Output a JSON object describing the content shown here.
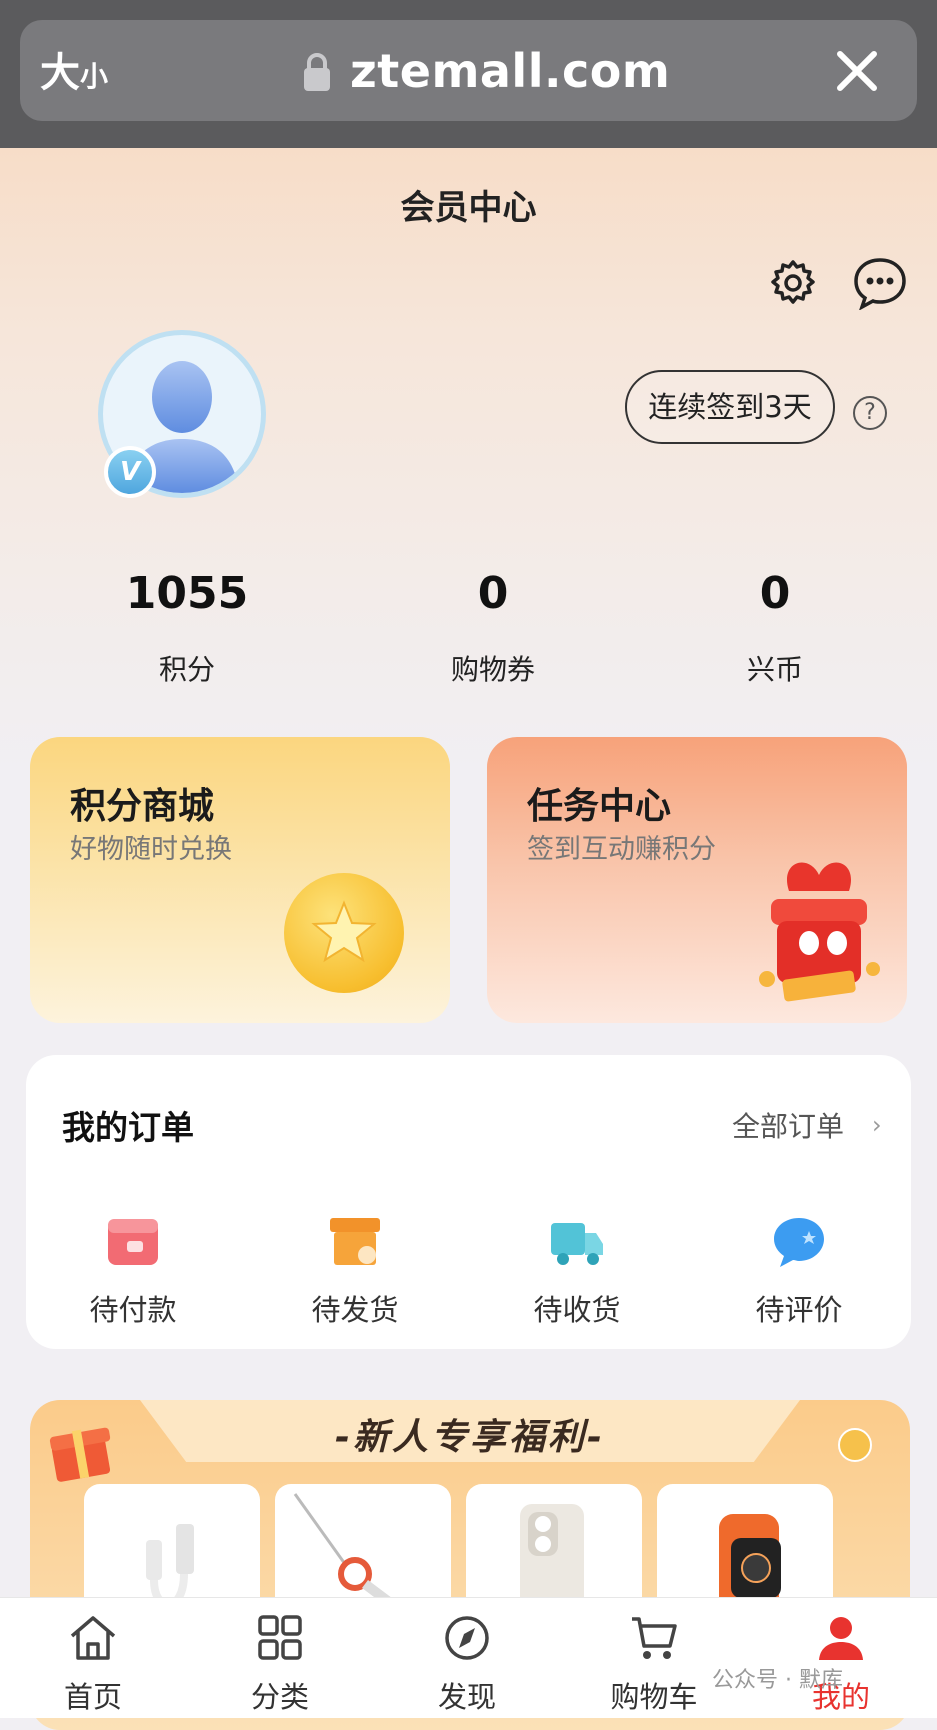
{
  "browser": {
    "size_label_big": "大",
    "size_label_small": "小",
    "url": "ztemall.com"
  },
  "page": {
    "title": "会员中心"
  },
  "user": {
    "badge": "V",
    "checkin_label": "连续签到3天",
    "help_label": "?"
  },
  "stats": [
    {
      "value": "1055",
      "label": "积分"
    },
    {
      "value": "0",
      "label": "购物券"
    },
    {
      "value": "0",
      "label": "兴币"
    }
  ],
  "cards": [
    {
      "title": "积分商城",
      "subtitle": "好物随时兑换"
    },
    {
      "title": "任务中心",
      "subtitle": "签到互动赚积分"
    }
  ],
  "orders": {
    "title": "我的订单",
    "all_label": "全部订单",
    "chevron": "›",
    "items": [
      {
        "label": "待付款",
        "icon": "wallet-icon",
        "color": "#f26b73"
      },
      {
        "label": "待发货",
        "icon": "box-icon",
        "color": "#f6a43a"
      },
      {
        "label": "待收货",
        "icon": "truck-icon",
        "color": "#52c3d7"
      },
      {
        "label": "待评价",
        "icon": "chat-bubble-icon",
        "color": "#3c9cf1"
      }
    ]
  },
  "banner": {
    "title": "-新人专享福利-"
  },
  "nav": [
    {
      "label": "首页",
      "icon": "home-icon"
    },
    {
      "label": "分类",
      "icon": "grid-icon"
    },
    {
      "label": "发现",
      "icon": "compass-icon"
    },
    {
      "label": "购物车",
      "icon": "cart-icon"
    },
    {
      "label": "我的",
      "icon": "user-icon",
      "active": true
    }
  ],
  "watermark": "公众号 · 默库",
  "colors": {
    "accent": "#e8332f"
  }
}
